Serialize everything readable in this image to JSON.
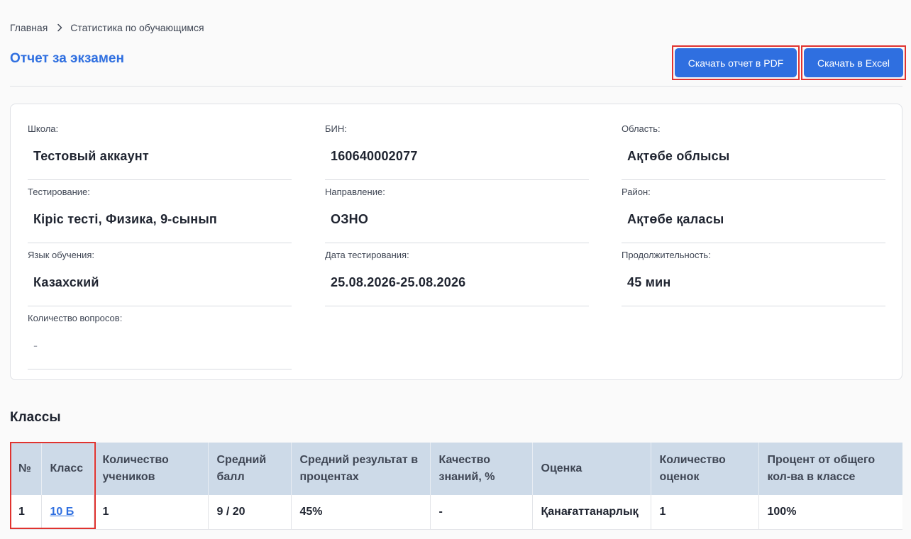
{
  "breadcrumb": {
    "home": "Главная",
    "current": "Статистика по обучающимся"
  },
  "page_title": "Отчет за экзамен",
  "actions": {
    "download_pdf": "Скачать отчет в PDF",
    "download_excel": "Скачать в Excel"
  },
  "info": {
    "school": {
      "label": "Школа:",
      "value": "Тестовый аккаунт"
    },
    "bin": {
      "label": "БИН:",
      "value": "160640002077"
    },
    "region": {
      "label": "Область:",
      "value": "Ақтөбе облысы"
    },
    "testing": {
      "label": "Тестирование:",
      "value": "Кіріс тесті, Физика, 9-сынып"
    },
    "direction": {
      "label": "Направление:",
      "value": "ОЗНО"
    },
    "district": {
      "label": "Район:",
      "value": "Ақтөбе қаласы"
    },
    "language": {
      "label": "Язык обучения:",
      "value": "Казахский"
    },
    "test_date": {
      "label": "Дата тестирования:",
      "value": "25.08.2026-25.08.2026"
    },
    "duration": {
      "label": "Продолжительность:",
      "value": "45 мин"
    },
    "questions": {
      "label": "Количество вопросов:",
      "value": "-"
    }
  },
  "classes": {
    "title": "Классы",
    "columns": [
      "№",
      "Класс",
      "Количество учеников",
      "Средний балл",
      "Средний результат в процентах",
      "Качество знаний, %",
      "Оценка",
      "Количество оценок",
      "Процент от общего кол-ва в классе"
    ],
    "rows": [
      {
        "num": "1",
        "class": "10 Б",
        "students": "1",
        "avg_score": "9 / 20",
        "avg_percent": "45%",
        "quality": "-",
        "grade": "Қанағаттанарлық",
        "grade_count": "1",
        "percent_total": "100%"
      }
    ]
  }
}
